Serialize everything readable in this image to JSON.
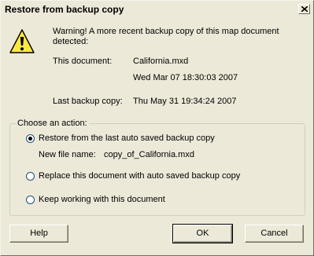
{
  "window": {
    "title": "Restore from backup copy"
  },
  "message": {
    "warning_line1": "Warning! A more recent backup copy of this map document",
    "warning_line2": "detected:",
    "this_document_label": "This document:",
    "this_document_name": "California.mxd",
    "this_document_date": "Wed Mar 07 18:30:03 2007",
    "last_backup_label": "Last backup copy:",
    "last_backup_date": "Thu May 31 19:34:24 2007"
  },
  "actions": {
    "group_label": "Choose an action:",
    "options": [
      {
        "label": "Restore from the last auto saved backup copy",
        "selected": true
      },
      {
        "label": "Replace this document with auto saved backup copy",
        "selected": false
      },
      {
        "label": "Keep working with this document",
        "selected": false
      }
    ],
    "new_file_label": "New file name:",
    "new_file_name": "copy_of_California.mxd"
  },
  "buttons": {
    "help": "Help",
    "ok": "OK",
    "cancel": "Cancel"
  }
}
